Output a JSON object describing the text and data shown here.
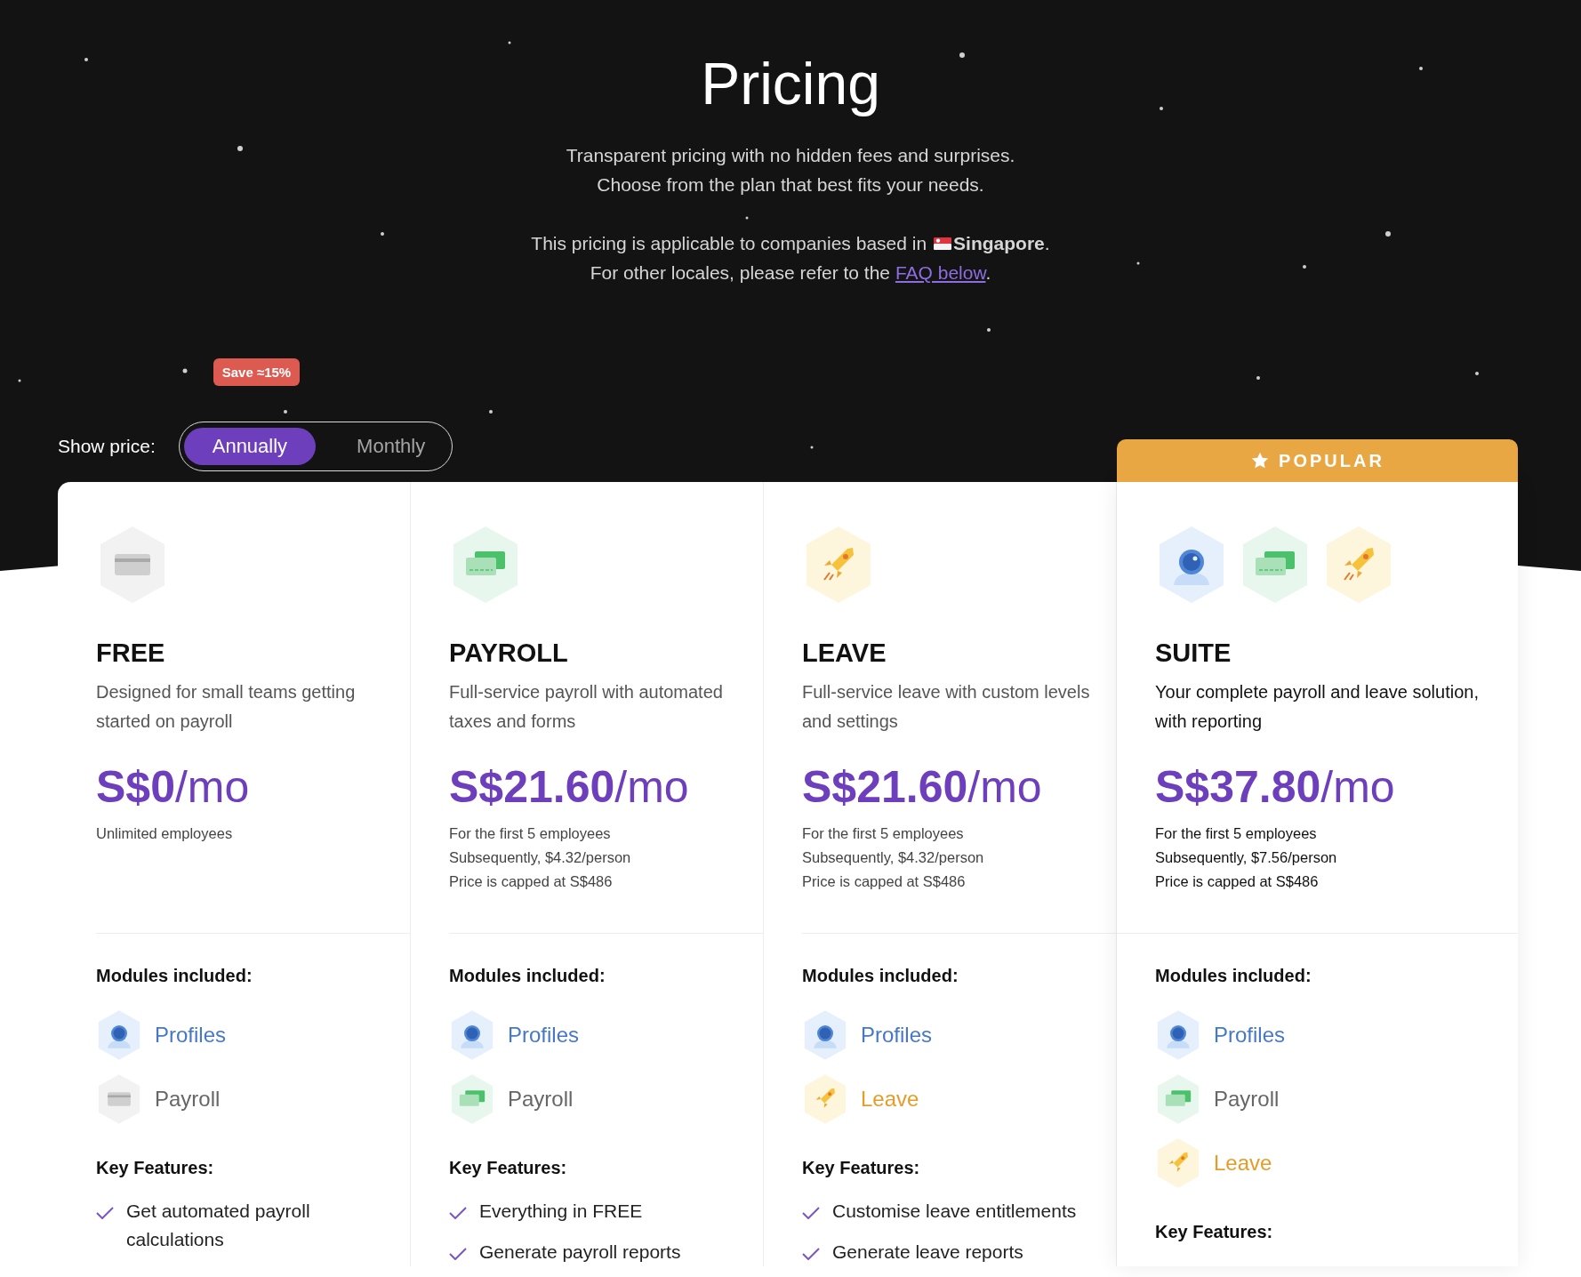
{
  "header": {
    "title": "Pricing",
    "intro": [
      "Transparent pricing with no hidden fees and surprises.",
      "Choose from the plan that best fits your needs."
    ],
    "locale_line": {
      "before": "This pricing is applicable to companies based in",
      "country": "**Singapore**."
    },
    "locale_note": {
      "text": "For other locales, please refer to the",
      "link": "FAQ below",
      "after": "."
    }
  },
  "price_toggle": {
    "label": "Show price:",
    "badge": "Save ≈15%",
    "options": [
      {
        "label": "Annually",
        "selected": true
      },
      {
        "label": "Monthly",
        "selected": false
      }
    ]
  },
  "plans": [
    {
      "name": "FREE",
      "popular": false,
      "icons": [
        {
          "kind": "payroll",
          "disabled": true
        }
      ],
      "description": "Designed for small teams getting started on payroll",
      "price": "**S$0**/mo",
      "notes": [
        "Unlimited employees"
      ],
      "modules_heading": "Modules included:",
      "modules": [
        {
          "kind": "profiles",
          "label": "Profiles",
          "disabled": false
        },
        {
          "kind": "payroll",
          "label": "Payroll",
          "disabled": true
        }
      ],
      "features_heading": "Key Features:",
      "features": [
        "Get automated payroll calculations"
      ]
    },
    {
      "name": "PAYROLL",
      "popular": false,
      "icons": [
        {
          "kind": "payroll",
          "disabled": false
        }
      ],
      "description": "Full-service payroll with automated taxes and forms",
      "price": "**S$21.60**/mo",
      "notes": [
        "For the first 5 employees",
        "Subsequently, $4.32/person",
        "Price is capped at S$486"
      ],
      "modules_heading": "Modules included:",
      "modules": [
        {
          "kind": "profiles",
          "label": "Profiles",
          "disabled": false
        },
        {
          "kind": "payroll",
          "label": "Payroll",
          "disabled": false
        }
      ],
      "features_heading": "Key Features:",
      "features": [
        "Everything in FREE",
        "Generate payroll reports"
      ]
    },
    {
      "name": "LEAVE",
      "popular": false,
      "icons": [
        {
          "kind": "leave",
          "disabled": false
        }
      ],
      "description": "Full-service leave with custom levels and settings",
      "price": "**S$21.60**/mo",
      "notes": [
        "For the first 5 employees",
        "Subsequently, $4.32/person",
        "Price is capped at S$486"
      ],
      "modules_heading": "Modules included:",
      "modules": [
        {
          "kind": "profiles",
          "label": "Profiles",
          "disabled": false
        },
        {
          "kind": "leave",
          "label": "Leave",
          "disabled": false
        }
      ],
      "features_heading": "Key Features:",
      "features": [
        "Customise leave entitlements",
        "Generate leave reports"
      ]
    },
    {
      "name": "SUITE",
      "popular": true,
      "badge": "POPULAR",
      "icons": [
        {
          "kind": "profiles",
          "disabled": false
        },
        {
          "kind": "payroll",
          "disabled": false
        },
        {
          "kind": "leave",
          "disabled": false
        }
      ],
      "description": "Your complete payroll and leave solution, with reporting",
      "price": "**S$37.80**/mo",
      "notes": [
        "For the first 5 employees",
        "Subsequently, $7.56/person",
        "Price is capped at S$486"
      ],
      "modules_heading": "Modules included:",
      "modules": [
        {
          "kind": "profiles",
          "label": "Profiles",
          "disabled": false
        },
        {
          "kind": "payroll",
          "label": "Payroll",
          "disabled": false
        },
        {
          "kind": "leave",
          "label": "Leave",
          "disabled": false
        }
      ],
      "features_heading": "Key Features:"
    }
  ]
}
